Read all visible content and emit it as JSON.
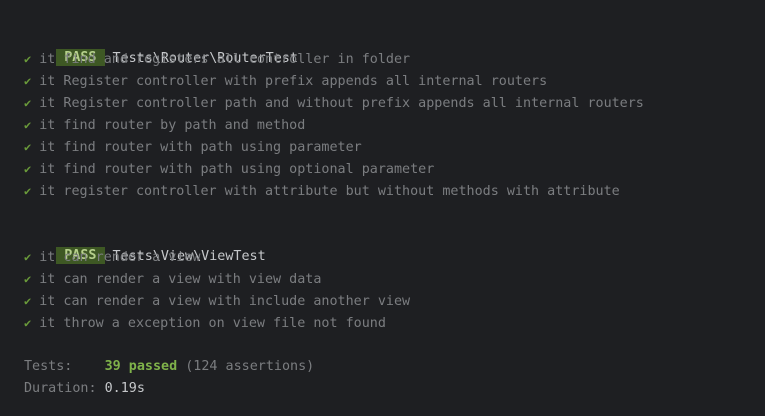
{
  "suites": [
    {
      "status": "PASS",
      "name": "Tests\\Router\\RouterTest",
      "tests": [
        "it find and registers all controller in folder",
        "it Register controller with prefix appends all internal routers",
        "it Register controller path and without prefix appends all internal routers",
        "it find router by path and method",
        "it find router with path using parameter",
        "it find router with path using optional parameter",
        "it register controller with attribute but without methods with attribute"
      ]
    },
    {
      "status": "PASS",
      "name": "Tests\\View\\ViewTest",
      "tests": [
        "it can render a view",
        "it can render a view with view data",
        "it can render a view with include another view",
        "it throw a exception on view file not found"
      ]
    }
  ],
  "check_glyph": "✔",
  "summary": {
    "tests_label": "Tests:",
    "passed": "39 passed",
    "assertions": "(124 assertions)",
    "duration_label": "Duration:",
    "duration": "0.19s"
  },
  "colors": {
    "background": "#1e1f22",
    "badge_bg": "#3e5824",
    "badge_fg": "#b6d08c",
    "pass_green": "#7fb24a",
    "muted_text": "#7b7d80"
  }
}
